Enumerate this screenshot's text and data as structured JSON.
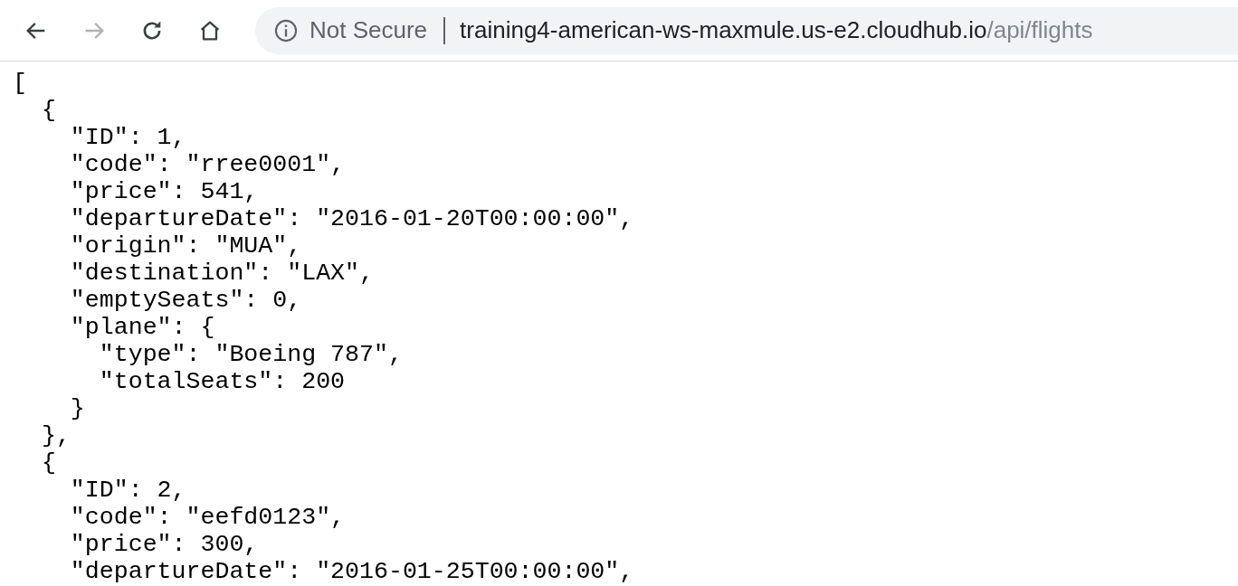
{
  "toolbar": {
    "buttons": [
      {
        "kind": "back",
        "disabled": false
      },
      {
        "kind": "forward",
        "disabled": true
      },
      {
        "kind": "reload",
        "disabled": false
      },
      {
        "kind": "home",
        "disabled": false
      }
    ]
  },
  "address_bar": {
    "security": "Not Secure",
    "host": "training4-american-ws-maxmule.us-e2.cloudhub.io",
    "path": "/api/flights"
  },
  "body_lines": [
    "[",
    "  {",
    "    \"ID\": 1,",
    "    \"code\": \"rree0001\",",
    "    \"price\": 541,",
    "    \"departureDate\": \"2016-01-20T00:00:00\",",
    "    \"origin\": \"MUA\",",
    "    \"destination\": \"LAX\",",
    "    \"emptySeats\": 0,",
    "    \"plane\": {",
    "      \"type\": \"Boeing 787\",",
    "      \"totalSeats\": 200",
    "    }",
    "  },",
    "  {",
    "    \"ID\": 2,",
    "    \"code\": \"eefd0123\",",
    "    \"price\": 300,",
    "    \"departureDate\": \"2016-01-25T00:00:00\","
  ]
}
